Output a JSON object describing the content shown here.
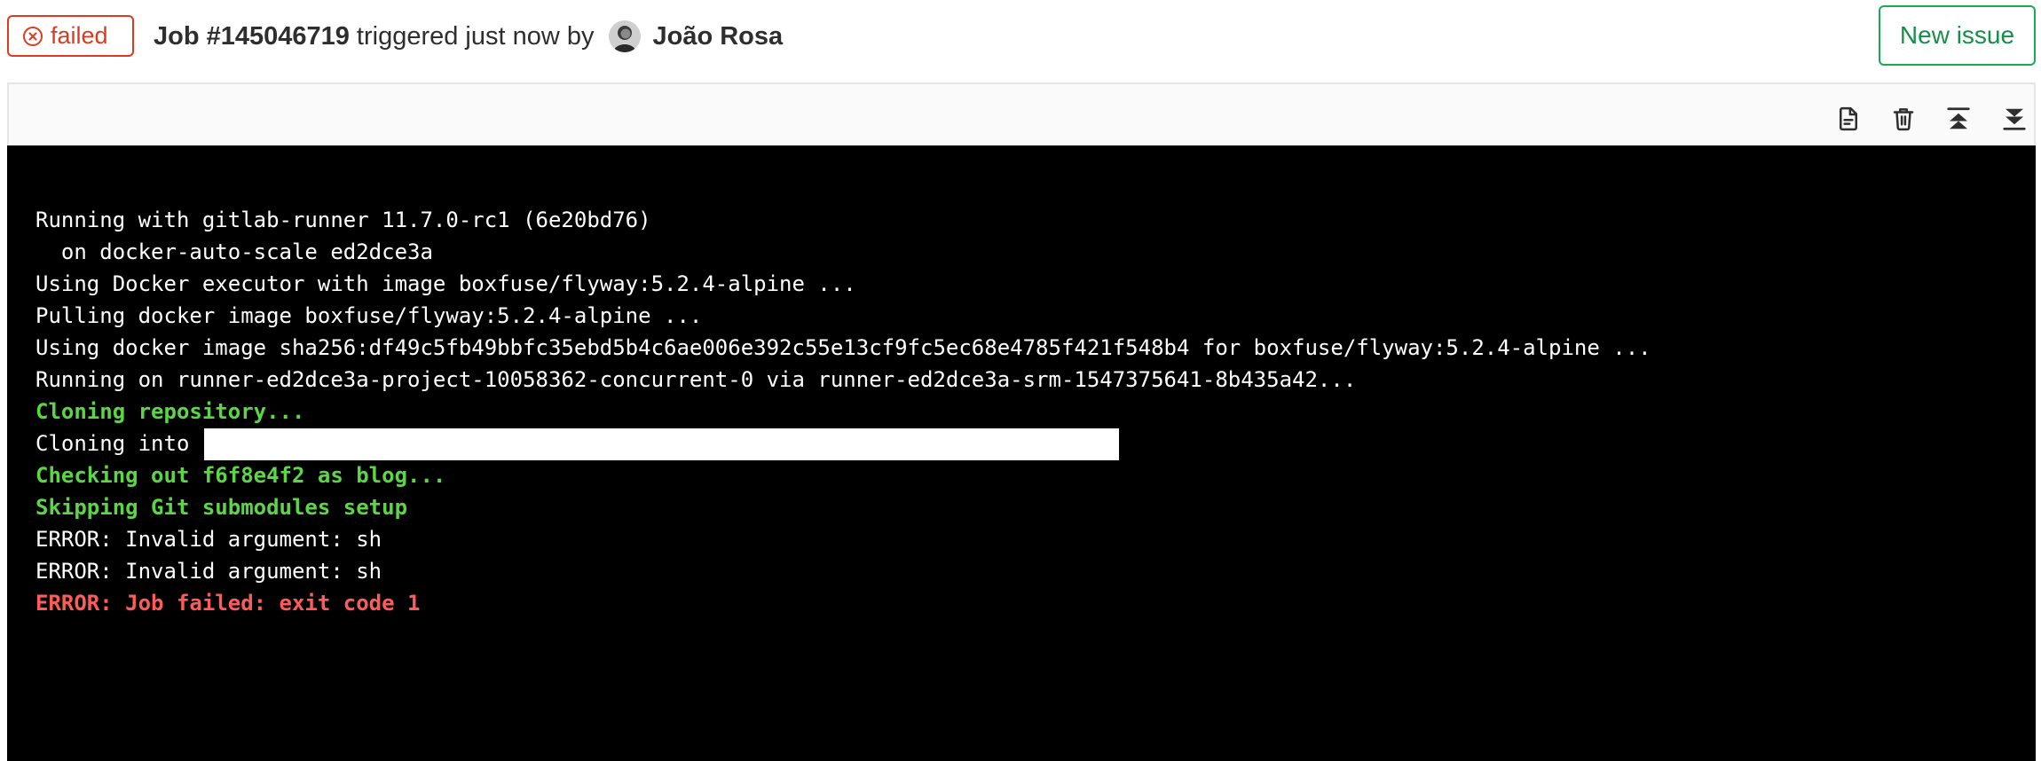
{
  "header": {
    "status": "failed",
    "job_id": "Job #145046719",
    "triggered_text": "triggered just now by",
    "user_name": "João Rosa",
    "new_issue_label": "New issue"
  },
  "toolbar": {
    "icons": [
      "raw-log-icon",
      "erase-log-icon",
      "scroll-top-icon",
      "scroll-bottom-icon"
    ]
  },
  "log": {
    "lines": [
      "Running with gitlab-runner 11.7.0-rc1 (6e20bd76)",
      "  on docker-auto-scale ed2dce3a",
      "Using Docker executor with image boxfuse/flyway:5.2.4-alpine ...",
      "Pulling docker image boxfuse/flyway:5.2.4-alpine ...",
      "Using docker image sha256:df49c5fb49bbfc35ebd5b4c6ae006e392c55e13cf9fc5ec68e4785f421f548b4 for boxfuse/flyway:5.2.4-alpine ...",
      "Running on runner-ed2dce3a-project-10058362-concurrent-0 via runner-ed2dce3a-srm-1547375641-8b435a42...",
      "Cloning repository...",
      "Cloning into",
      "Checking out f6f8e4f2 as blog...",
      "Skipping Git submodules setup",
      "ERROR: Invalid argument: sh",
      "ERROR: Invalid argument: sh",
      "ERROR: Job failed: exit code 1"
    ]
  },
  "colors": {
    "failed": "#db3b21",
    "success_green": "#1aaa55",
    "log_green": "#5bd645",
    "log_red": "#ff5b5b",
    "log_background": "#000000"
  }
}
